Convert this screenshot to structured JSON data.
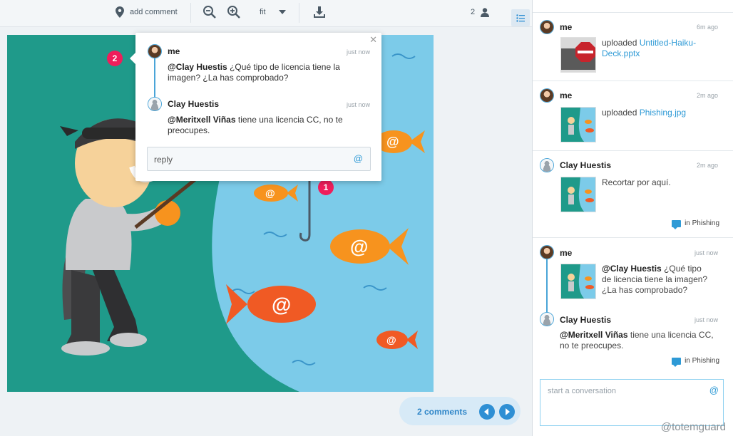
{
  "toolbar": {
    "add_comment": "add comment",
    "zoom_value": "fit",
    "user_count": "2"
  },
  "canvas": {
    "pin_2": "2",
    "pin_1": "1"
  },
  "popup": {
    "comment1": {
      "author": "me",
      "time": "just now",
      "mention": "@Clay Huestis",
      "text": " ¿Qué tipo de licencia tiene la imagen? ¿La has comprobado?"
    },
    "comment2": {
      "author": "Clay Huestis",
      "time": "just now",
      "mention": "@Meritxell Viñas",
      "text": " tiene una licencia CC, no te preocupes."
    },
    "reply_placeholder": "reply",
    "at": "@"
  },
  "pager": {
    "label": "2 comments"
  },
  "sidebar": {
    "activity": [
      {
        "author": "me",
        "time": "6m ago",
        "prefix": "uploaded ",
        "link": "Untitled-Haiku-Deck.pptx"
      },
      {
        "author": "me",
        "time": "2m ago",
        "prefix": "uploaded ",
        "link": "Phishing.jpg"
      },
      {
        "author": "Clay Huestis",
        "time": "2m ago",
        "text": "Recortar por aquí.",
        "tag": "in Phishing"
      },
      {
        "author": "me",
        "time": "just now",
        "mention": "@Clay Huestis",
        "text": " ¿Qué tipo de licencia tiene la imagen? ¿La has comprobado?"
      },
      {
        "author": "Clay Huestis",
        "time": "just now",
        "mention": "@Meritxell Viñas",
        "text": " tiene una licencia CC, no te preocupes.",
        "tag": "in Phishing"
      }
    ],
    "compose_placeholder": "start a conversation",
    "at": "@"
  },
  "watermark": "@totemguard",
  "colors": {
    "accent": "#2e9ad6",
    "pin": "#ef1e5b",
    "teal": "#1f9a8a",
    "water": "#7ccbe9",
    "fish": "#f7931e"
  }
}
